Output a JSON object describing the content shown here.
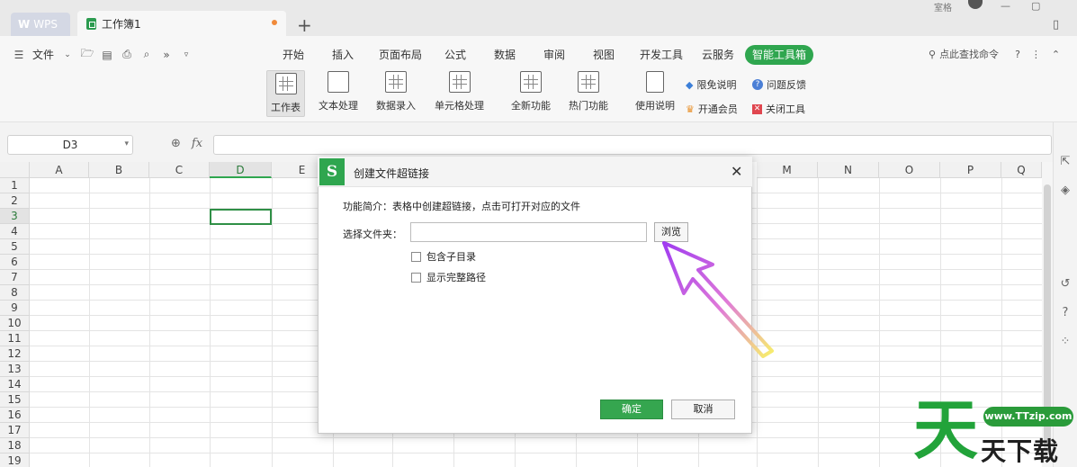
{
  "titlebar": {
    "wps_tab": "WPS",
    "doc_tab": "工作簿1",
    "user_text": "室格"
  },
  "menu": {
    "file_label": "文件",
    "tabs": [
      {
        "label": "开始",
        "active": false
      },
      {
        "label": "插入",
        "active": false
      },
      {
        "label": "页面布局",
        "active": false
      },
      {
        "label": "公式",
        "active": false
      },
      {
        "label": "数据",
        "active": false
      },
      {
        "label": "审阅",
        "active": false
      },
      {
        "label": "视图",
        "active": false
      },
      {
        "label": "开发工具",
        "active": false
      },
      {
        "label": "云服务",
        "active": false
      },
      {
        "label": "智能工具箱",
        "active": true
      }
    ],
    "search_placeholder": "点此查找命令"
  },
  "ribbon": {
    "buttons": [
      "工作表",
      "文本处理",
      "数据录入",
      "单元格处理",
      "全新功能",
      "热门功能",
      "使用说明"
    ],
    "small": {
      "free_info": "限免说明",
      "feedback": "问题反馈",
      "open_member": "开通会员",
      "close_tool": "关闭工具"
    }
  },
  "formula_bar": {
    "cell_ref": "D3",
    "fx": "fx"
  },
  "sheet": {
    "columns": [
      "A",
      "B",
      "C",
      "D",
      "E",
      "M",
      "N",
      "O",
      "P",
      "Q"
    ],
    "rows": [
      "1",
      "2",
      "3",
      "4",
      "5",
      "6",
      "7",
      "8",
      "9",
      "10",
      "11",
      "12",
      "13",
      "14",
      "15",
      "16",
      "17",
      "18",
      "19"
    ],
    "selected_col": "D",
    "selected_row": "3"
  },
  "dialog": {
    "logo": "S",
    "title": "创建文件超链接",
    "description": "功能简介：表格中创建超链接，点击可打开对应的文件",
    "folder_label": "选择文件夹：",
    "folder_value": "",
    "browse": "浏览",
    "include_subdirs": "包含子目录",
    "show_full_path": "显示完整路径",
    "ok": "确定",
    "cancel": "取消"
  },
  "watermark": {
    "big_char": "天",
    "url": "www.TTzip.com",
    "text": "天下载"
  },
  "colors": {
    "accent": "#2fa64f",
    "arrow_start": "#a03cf0",
    "arrow_end": "#f7f06a"
  }
}
